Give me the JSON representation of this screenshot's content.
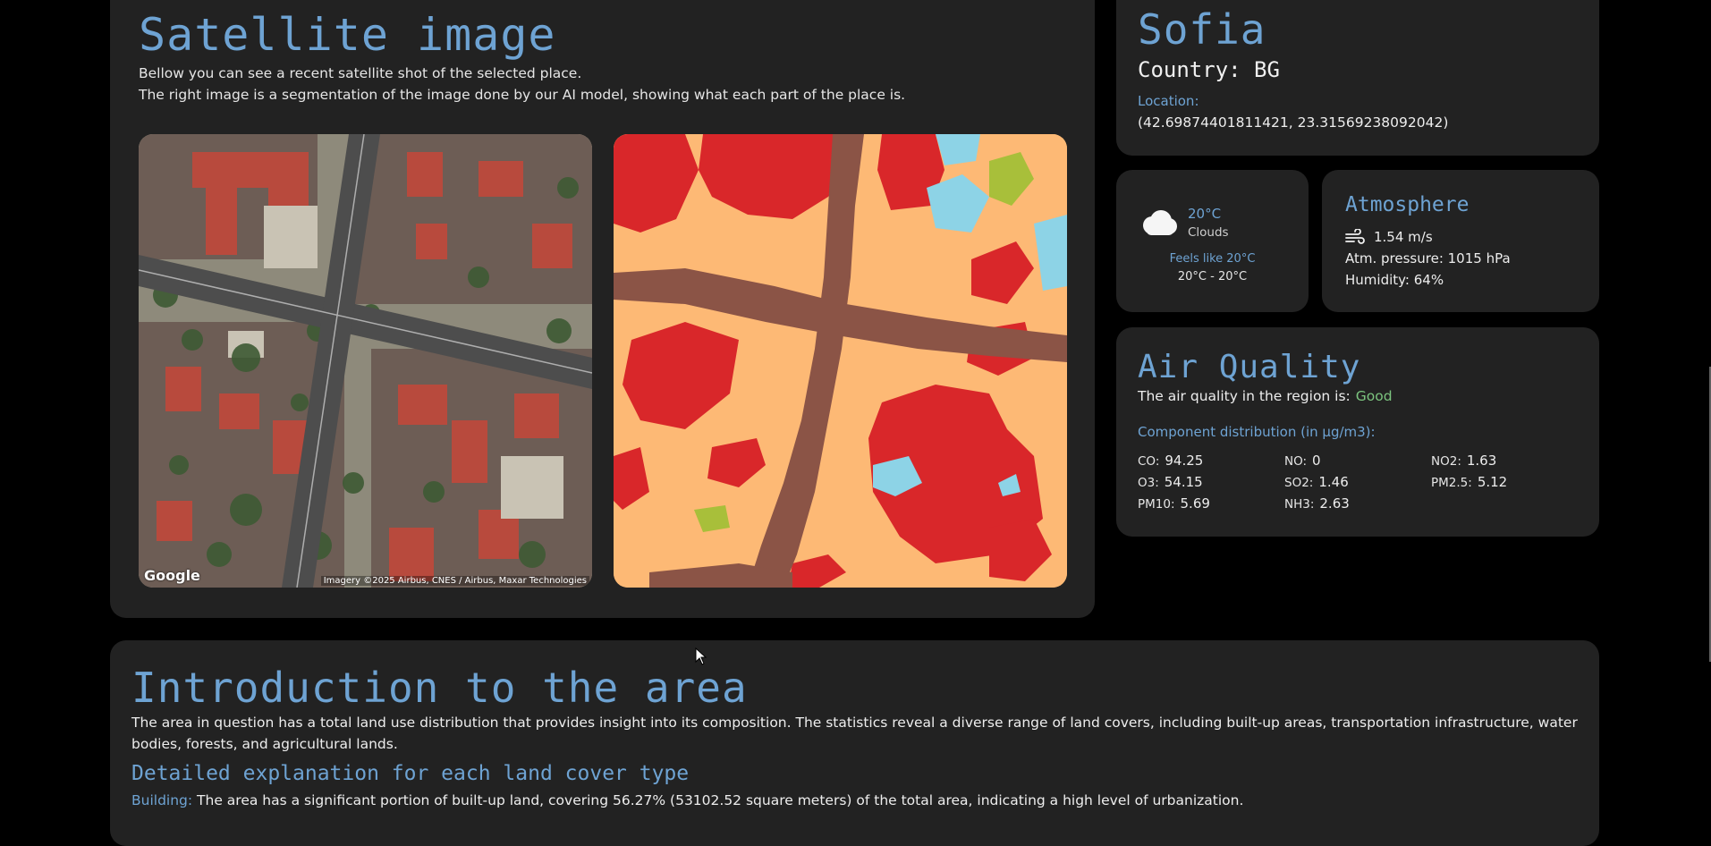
{
  "satellite": {
    "title": "Satellite image",
    "desc_line1": "Bellow you can see a recent satellite shot of the selected place.",
    "desc_line2": "The right image is a segmentation of the image done by our AI model, showing what each part of the place is.",
    "photo_attribution_logo": "Google",
    "photo_attribution": "Imagery ©2025 Airbus, CNES / Airbus, Maxar Technologies",
    "segmentation_colors": {
      "building": "#d9272a",
      "road": "#8b5446",
      "land": "#fdb975",
      "water": "#8dd3e6",
      "vegetation": "#a8bf3a"
    }
  },
  "city": {
    "name": "Sofia",
    "country": "Country: BG",
    "location_label": "Location:",
    "location_value": "(42.69874401811421, 23.31569238092042)"
  },
  "weather": {
    "icon": "cloud-icon",
    "temp": "20°C",
    "condition": "Clouds",
    "feels_like": "Feels like 20°C",
    "range": "20°C - 20°C"
  },
  "atmosphere": {
    "title": "Atmosphere",
    "wind_icon": "wind-icon",
    "wind": "1.54 m/s",
    "pressure": "Atm. pressure:  1015 hPa",
    "humidity": "Humidity:  64%"
  },
  "air_quality": {
    "title": "Air Quality",
    "label": "The air quality in the region is:",
    "value": "Good",
    "component_label": "Component distribution (in μg/m3):",
    "components": [
      {
        "key": "CO:",
        "value": "94.25"
      },
      {
        "key": "NO:",
        "value": "0"
      },
      {
        "key": "NO2:",
        "value": "1.63"
      },
      {
        "key": "O3:",
        "value": "54.15"
      },
      {
        "key": "SO2:",
        "value": "1.46"
      },
      {
        "key": "PM2.5:",
        "value": "5.12"
      },
      {
        "key": "PM10:",
        "value": "5.69"
      },
      {
        "key": "NH3:",
        "value": "2.63"
      }
    ]
  },
  "intro": {
    "title": "Introduction to the area",
    "text": "The area in question has a total land use distribution that provides insight into its composition. The statistics reveal a diverse range of land covers, including built-up areas, transportation infrastructure, water bodies, forests, and agricultural lands.",
    "detail_title": "Detailed explanation for each land cover type",
    "building_label": "Building:",
    "building_text": " The area has a significant portion of built-up land, covering 56.27% (53102.52 square meters) of the total area, indicating a high level of urbanization."
  },
  "colors": {
    "accent": "#6ea3d3",
    "card": "#222222",
    "good": "#7cc47f"
  }
}
